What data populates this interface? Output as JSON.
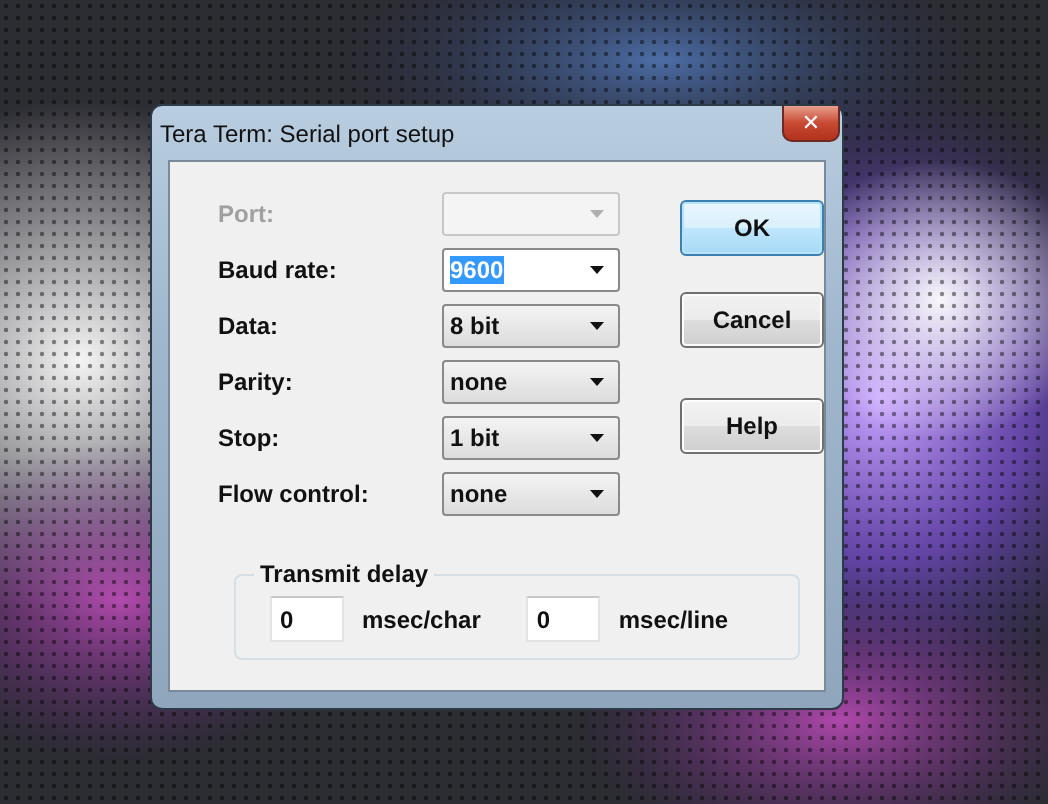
{
  "window": {
    "title": "Tera Term: Serial port setup",
    "close": "✕"
  },
  "fields": [
    {
      "label": "Port:",
      "disabled": true,
      "text_selected": false
    },
    {
      "label": "Baud rate:",
      "value": "9600",
      "disabled": false,
      "text_selected": true
    },
    {
      "label": "Data:",
      "value": "8 bit",
      "disabled": false,
      "text_selected": false
    },
    {
      "label": "Parity:",
      "value": "none",
      "disabled": false,
      "text_selected": false
    },
    {
      "label": "Stop:",
      "value": "1 bit",
      "disabled": false,
      "text_selected": false
    },
    {
      "label": "Flow control:",
      "value": "none",
      "disabled": false,
      "text_selected": false
    }
  ],
  "buttons": [
    {
      "label": "OK",
      "default": true
    },
    {
      "label": "Cancel",
      "default": false
    },
    {
      "label": "Help",
      "default": false
    }
  ],
  "transmit_delay": {
    "title": "Transmit delay",
    "inputs": [
      {
        "value": "0",
        "unit": "msec/char"
      },
      {
        "value": "0",
        "unit": "msec/line"
      }
    ]
  }
}
